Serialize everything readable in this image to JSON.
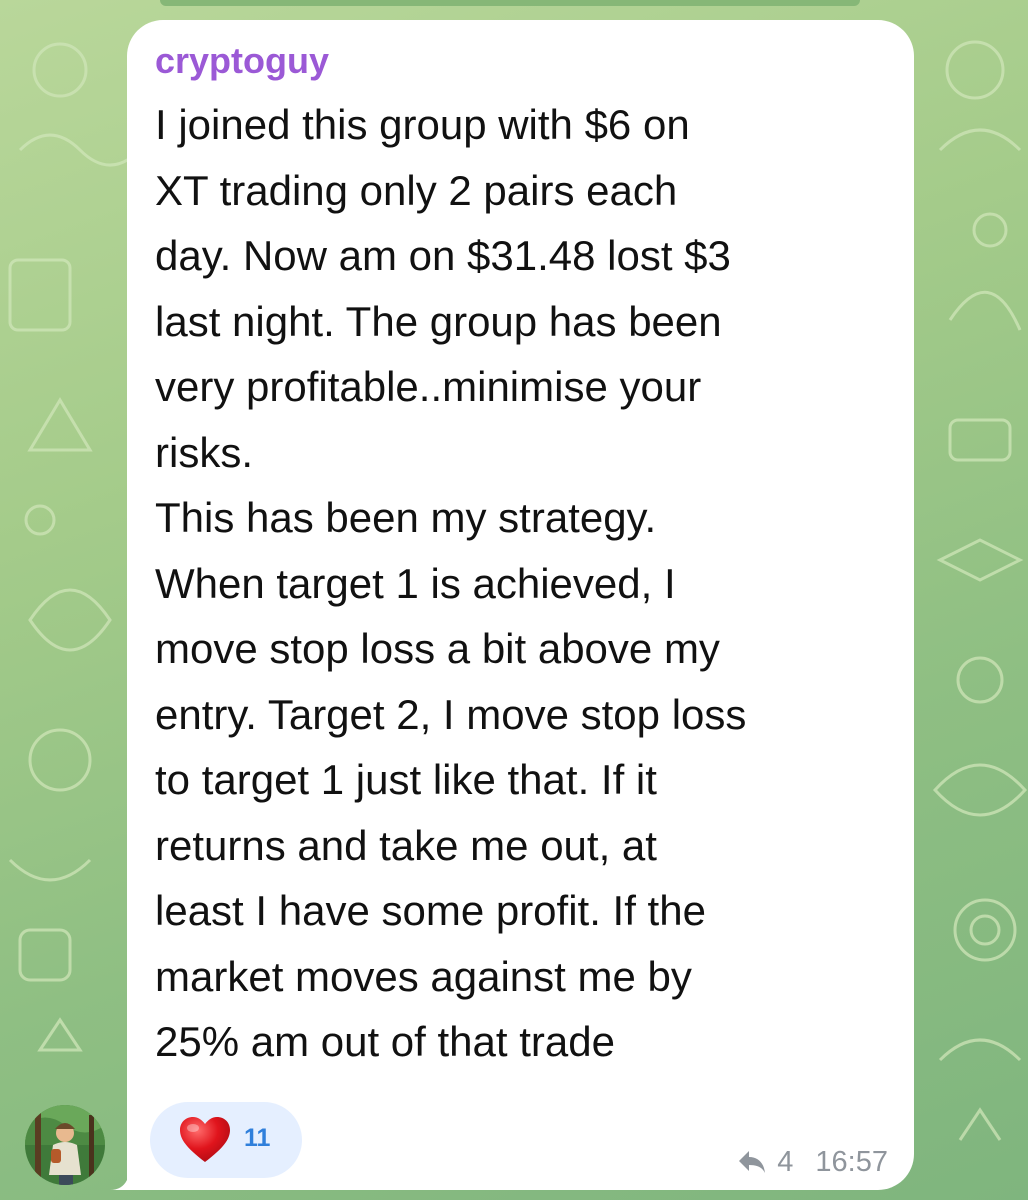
{
  "message": {
    "sender": "cryptoguy",
    "lines": [
      "I joined this group with $6 on",
      "XT trading only 2 pairs each",
      "day. Now am on $31.48 lost $3",
      "last night. The group has been",
      "very profitable..minimise your",
      "risks.",
      "This has been my strategy.",
      "When target 1 is achieved, I",
      "move stop loss a bit above my",
      "entry. Target 2, I move stop loss",
      "to target 1 just like that. If it",
      "returns and take me out, at",
      "least I have some profit. If the",
      "market moves against me by",
      "25% am out of that trade"
    ],
    "reaction": {
      "icon": "heart-icon",
      "count": "11"
    },
    "replies": {
      "icon": "reply-arrow-icon",
      "count": "4"
    },
    "time": "16:57"
  },
  "colors": {
    "background": "#a4cb8a",
    "bubble": "#ffffff",
    "sender_name": "#9b59d6",
    "text": "#111111",
    "reaction_bg": "#e5efff",
    "reaction_count": "#2f7fdb",
    "heart": "#e0141c",
    "meta": "#8f959c"
  }
}
